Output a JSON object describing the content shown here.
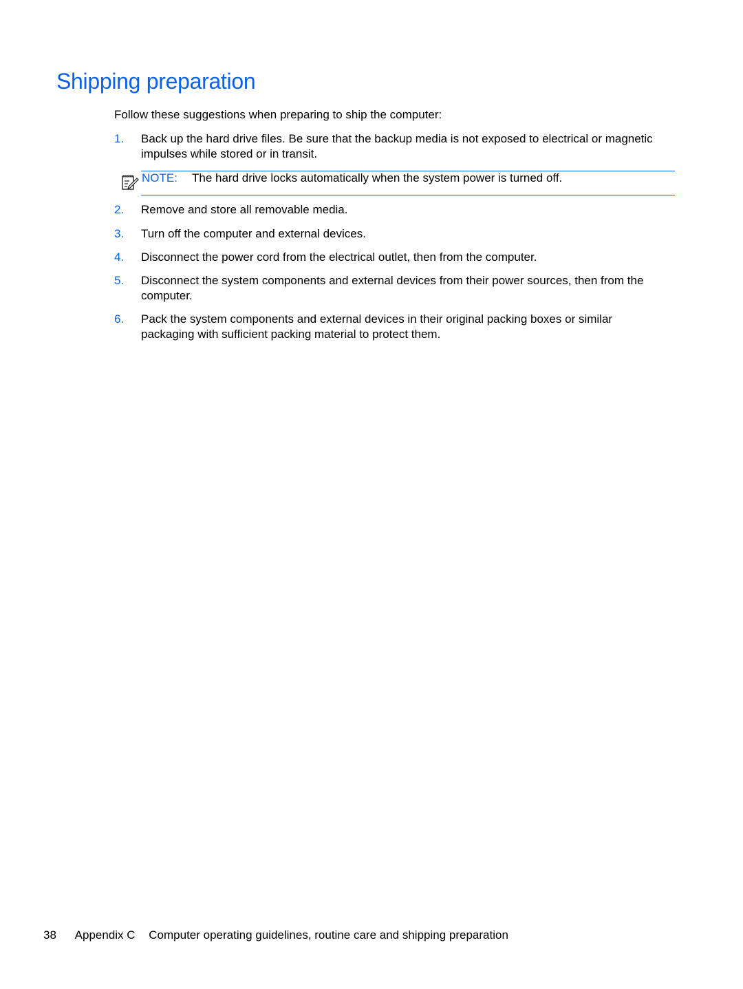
{
  "heading": "Shipping preparation",
  "intro": "Follow these suggestions when preparing to ship the computer:",
  "steps": [
    {
      "num": "1.",
      "text": "Back up the hard drive files. Be sure that the backup media is not exposed to electrical or magnetic impulses while stored or in transit."
    },
    {
      "num": "2.",
      "text": "Remove and store all removable media."
    },
    {
      "num": "3.",
      "text": "Turn off the computer and external devices."
    },
    {
      "num": "4.",
      "text": "Disconnect the power cord from the electrical outlet, then from the computer."
    },
    {
      "num": "5.",
      "text": "Disconnect the system components and external devices from their power sources, then from the computer."
    },
    {
      "num": "6.",
      "text": "Pack the system components and external devices in their original packing boxes or similar packaging with sufficient packing material to protect them."
    }
  ],
  "note": {
    "icon": "note-pencil-icon",
    "label": "NOTE:",
    "text": "The hard drive locks automatically when the system power is turned off."
  },
  "footer": {
    "page_number": "38",
    "appendix": "Appendix C",
    "chapter_title": "Computer operating guidelines, routine care and shipping preparation"
  },
  "colors": {
    "accent": "#0b62e8",
    "text": "#000000"
  }
}
